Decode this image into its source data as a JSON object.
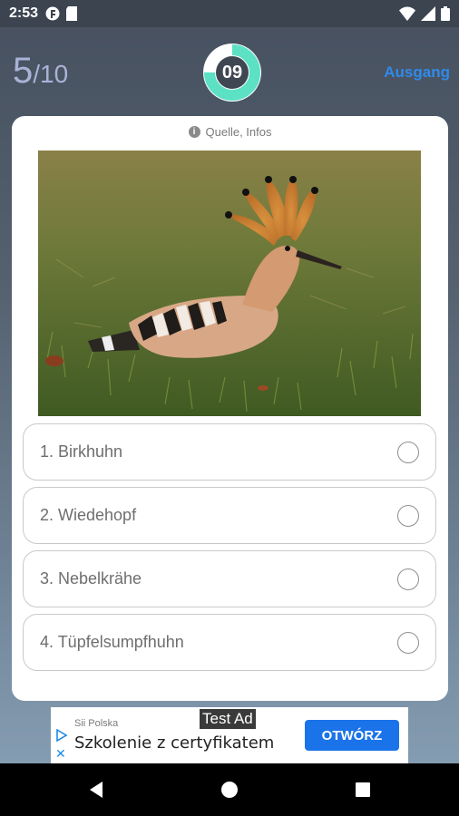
{
  "status_bar": {
    "time": "2:53"
  },
  "quiz": {
    "current": "5",
    "separator": "/",
    "total": "10",
    "timer": "09",
    "timer_remaining_fraction": 0.75,
    "exit_label": "Ausgang"
  },
  "card": {
    "source_label": "Quelle, Infos",
    "answers": [
      {
        "label": "1. Birkhuhn"
      },
      {
        "label": "2. Wiedehopf"
      },
      {
        "label": "3. Nebelkrähe"
      },
      {
        "label": "4. Tüpfelsumpfhuhn"
      }
    ]
  },
  "ad": {
    "tag": "Test Ad",
    "advertiser": "Sii Polska",
    "headline": "Szkolenie z certyfikatem",
    "cta": "OTWÓRZ"
  },
  "colors": {
    "accent": "#2f8bea",
    "timer_ring": "#5ce1c5",
    "cta": "#1a73e8"
  }
}
